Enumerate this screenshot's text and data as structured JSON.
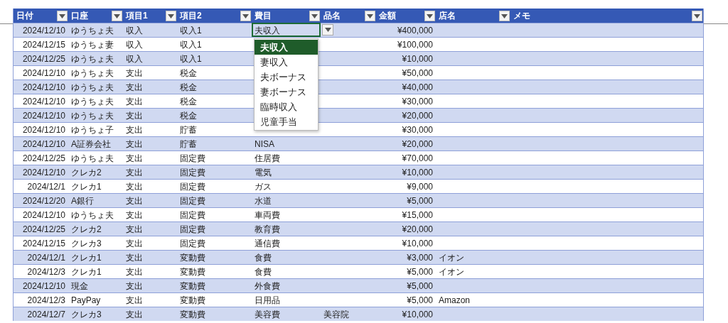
{
  "columns": [
    {
      "label": "日付"
    },
    {
      "label": "口座"
    },
    {
      "label": "項目1"
    },
    {
      "label": "項目2"
    },
    {
      "label": "費目"
    },
    {
      "label": "品名"
    },
    {
      "label": "金額"
    },
    {
      "label": "店名"
    },
    {
      "label": "メモ"
    }
  ],
  "rows": [
    {
      "selected": true,
      "date": "2024/12/10",
      "account": "ゆうちょ夫",
      "item1": "収入",
      "item2": "収入1",
      "category": "夫収入",
      "amount": "¥400,000"
    },
    {
      "selected": false,
      "date": "2024/12/15",
      "account": "ゆうちょ妻",
      "item1": "収入",
      "item2": "収入1",
      "amount": "¥100,000"
    },
    {
      "selected": false,
      "date": "2024/12/25",
      "account": "ゆうちょ夫",
      "item1": "収入",
      "item2": "収入1",
      "amount": "¥10,000"
    },
    {
      "selected": false,
      "date": "2024/12/10",
      "account": "ゆうちょ夫",
      "item1": "支出",
      "item2": "税金",
      "amount": "¥50,000"
    },
    {
      "selected": false,
      "date": "2024/12/10",
      "account": "ゆうちょ夫",
      "item1": "支出",
      "item2": "税金",
      "amount": "¥40,000"
    },
    {
      "selected": false,
      "date": "2024/12/10",
      "account": "ゆうちょ夫",
      "item1": "支出",
      "item2": "税金",
      "amount": "¥30,000"
    },
    {
      "selected": false,
      "date": "2024/12/10",
      "account": "ゆうちょ夫",
      "item1": "支出",
      "item2": "税金",
      "amount": "¥20,000"
    },
    {
      "selected": false,
      "date": "2024/12/10",
      "account": "ゆうちょ子",
      "item1": "支出",
      "item2": "貯蓄",
      "amount": "¥30,000"
    },
    {
      "selected": false,
      "date": "2024/12/10",
      "account": "A証券会社",
      "item1": "支出",
      "item2": "貯蓄",
      "category": "NISA",
      "amount": "¥20,000"
    },
    {
      "selected": false,
      "date": "2024/12/25",
      "account": "ゆうちょ夫",
      "item1": "支出",
      "item2": "固定費",
      "category": "住居費",
      "amount": "¥70,000"
    },
    {
      "selected": false,
      "date": "2024/12/10",
      "account": "クレカ2",
      "item1": "支出",
      "item2": "固定費",
      "category": "電気",
      "amount": "¥10,000"
    },
    {
      "selected": false,
      "date": "2024/12/1",
      "account": "クレカ1",
      "item1": "支出",
      "item2": "固定費",
      "category": "ガス",
      "amount": "¥9,000"
    },
    {
      "selected": false,
      "date": "2024/12/20",
      "account": "A銀行",
      "item1": "支出",
      "item2": "固定費",
      "category": "水道",
      "amount": "¥5,000"
    },
    {
      "selected": false,
      "date": "2024/12/10",
      "account": "ゆうちょ夫",
      "item1": "支出",
      "item2": "固定費",
      "category": "車両費",
      "amount": "¥15,000"
    },
    {
      "selected": false,
      "date": "2024/12/25",
      "account": "クレカ2",
      "item1": "支出",
      "item2": "固定費",
      "category": "教育費",
      "amount": "¥20,000"
    },
    {
      "selected": false,
      "date": "2024/12/15",
      "account": "クレカ3",
      "item1": "支出",
      "item2": "固定費",
      "category": "通信費",
      "amount": "¥10,000"
    },
    {
      "selected": false,
      "date": "2024/12/1",
      "account": "クレカ1",
      "item1": "支出",
      "item2": "変動費",
      "category": "食費",
      "amount": "¥3,000",
      "shop": "イオン"
    },
    {
      "selected": false,
      "date": "2024/12/3",
      "account": "クレカ1",
      "item1": "支出",
      "item2": "変動費",
      "category": "食費",
      "amount": "¥5,000",
      "shop": "イオン"
    },
    {
      "selected": false,
      "date": "2024/12/10",
      "account": "現金",
      "item1": "支出",
      "item2": "変動費",
      "category": "外食費",
      "amount": "¥5,000"
    },
    {
      "selected": false,
      "date": "2024/12/3",
      "account": "PayPay",
      "item1": "支出",
      "item2": "変動費",
      "category": "日用品",
      "amount": "¥5,000",
      "shop": "Amazon"
    },
    {
      "selected": false,
      "date": "2024/12/7",
      "account": "クレカ3",
      "item1": "支出",
      "item2": "変動費",
      "category": "美容費",
      "product": "美容院",
      "amount": "¥10,000"
    }
  ],
  "dropdown": {
    "items": [
      {
        "label": "夫収入",
        "selected": true
      },
      {
        "label": "妻収入",
        "selected": false
      },
      {
        "label": "夫ボーナス",
        "selected": false
      },
      {
        "label": "妻ボーナス",
        "selected": false
      },
      {
        "label": "臨時収入",
        "selected": false
      },
      {
        "label": "児童手当",
        "selected": false
      }
    ]
  }
}
